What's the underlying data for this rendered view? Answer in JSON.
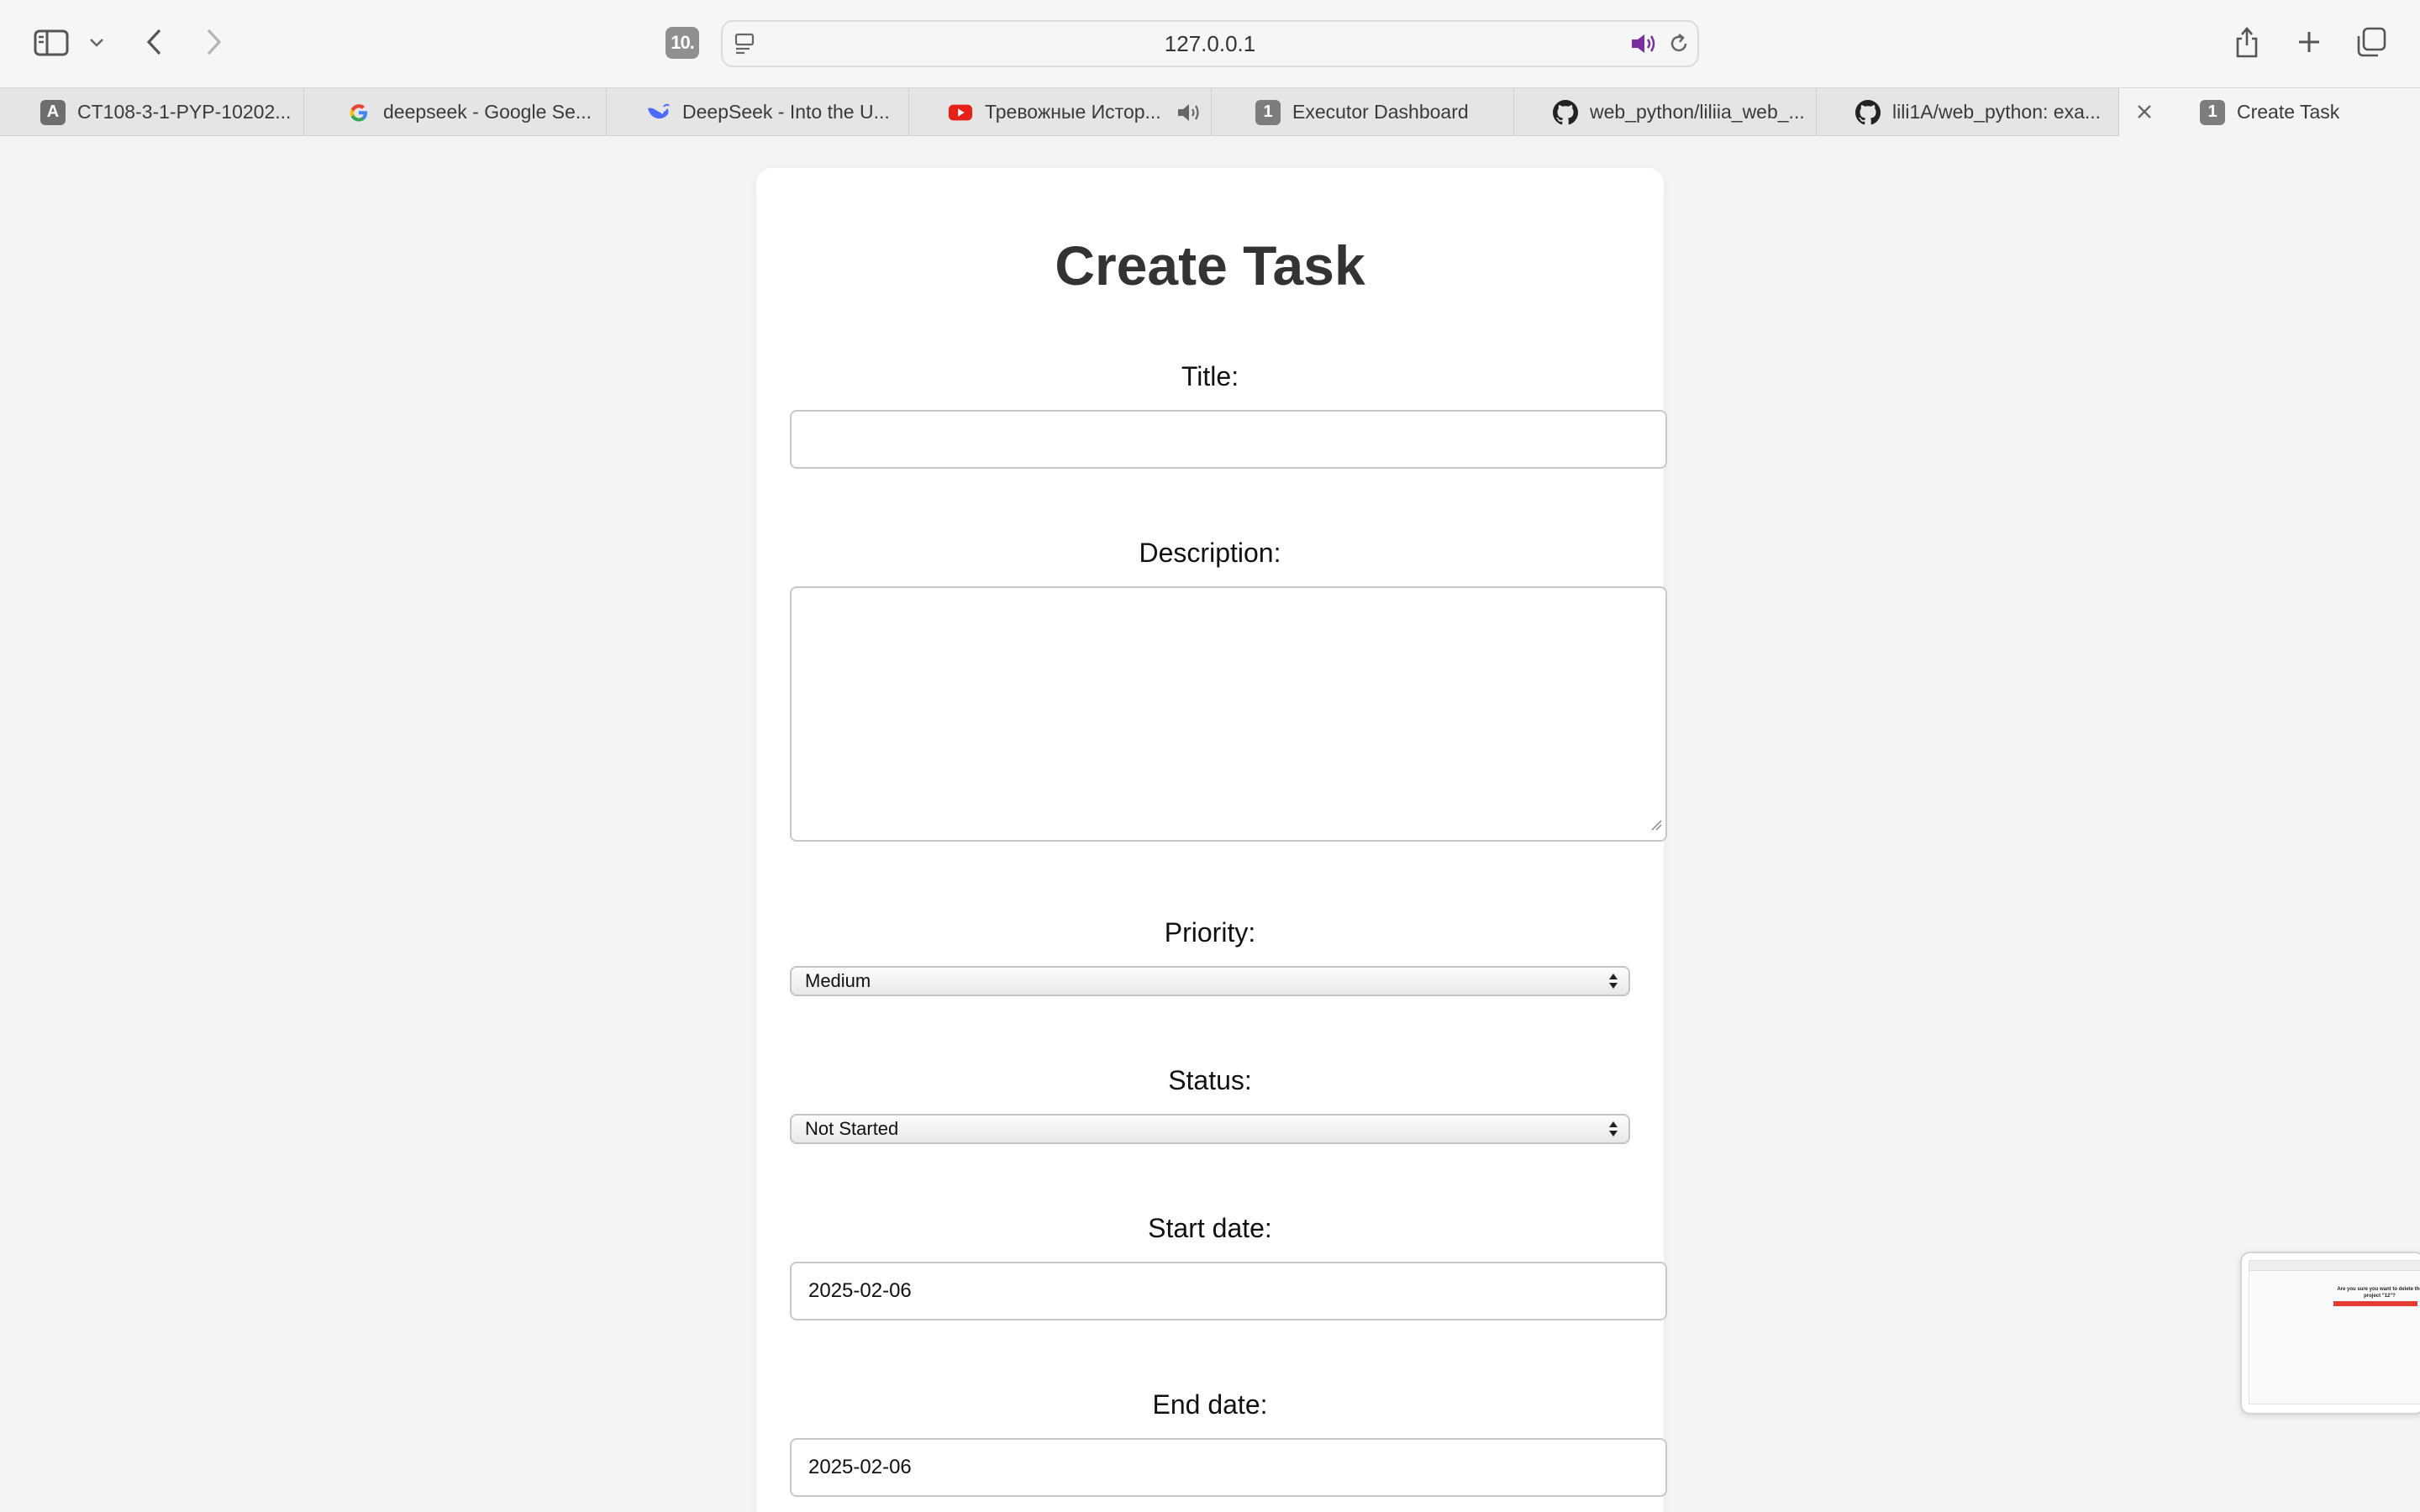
{
  "browser": {
    "url": "127.0.0.1",
    "extension_badge": "10.",
    "tabs": [
      {
        "label": "CT108-3-1-PYP-10202...",
        "favicon": "letter-a-icon",
        "fav_text": "A"
      },
      {
        "label": "deepseek - Google Se...",
        "favicon": "google-icon"
      },
      {
        "label": "DeepSeek - Into the U...",
        "favicon": "deepseek-whale-icon"
      },
      {
        "label": "Тревожные Истор...",
        "favicon": "youtube-icon",
        "audio": true
      },
      {
        "label": "Executor Dashboard",
        "favicon": "number-badge-icon",
        "fav_text": "1"
      },
      {
        "label": "web_python/liliia_web_...",
        "favicon": "github-icon"
      },
      {
        "label": "lili1A/web_python: exa...",
        "favicon": "github-icon"
      },
      {
        "label": "Create Task",
        "favicon": "number-badge-icon",
        "fav_text": "1",
        "active": true
      }
    ]
  },
  "form": {
    "title": "Create Task",
    "title_label": "Title:",
    "title_value": "",
    "description_label": "Description:",
    "description_value": "",
    "priority_label": "Priority:",
    "priority_value": "Medium",
    "status_label": "Status:",
    "status_value": "Not Started",
    "start_date_label": "Start date:",
    "start_date_value": "2025-02-06",
    "end_date_label": "End date:",
    "end_date_value": "2025-02-06"
  },
  "thumbnail": {
    "text": "Are you sure you want to delete the project \"12\"?"
  },
  "colors": {
    "page_bg": "#f4f4f4",
    "card_bg": "#ffffff",
    "audio_icon": "#7b2f9e",
    "youtube_red": "#e62117",
    "thumb_red": "#e53935"
  }
}
